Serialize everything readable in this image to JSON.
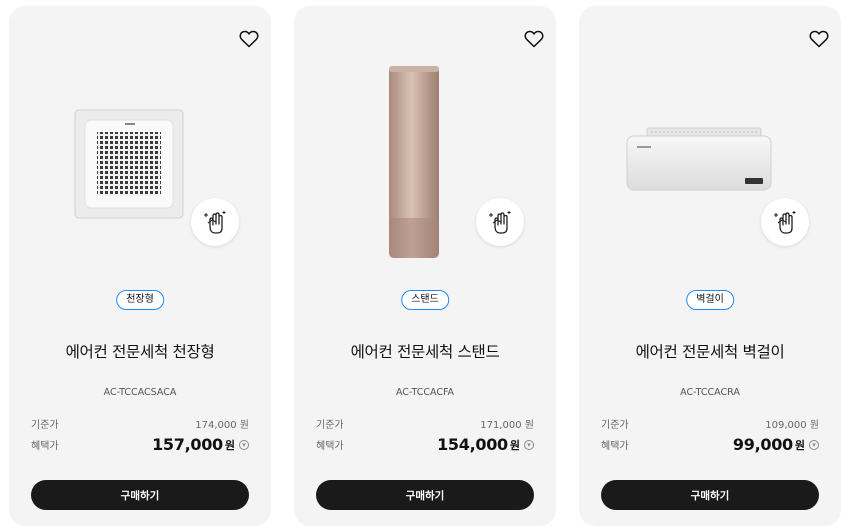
{
  "colors": {
    "accent": "#2189ff",
    "button": "#1a1a1a",
    "card": "#f4f4f4"
  },
  "icons": {
    "wishlist": "heart-outline-icon",
    "clean_service": "hand-wipe-sparkle-icon",
    "info": "info-circle-icon"
  },
  "products": [
    {
      "tag": "천장형",
      "title": "에어컨 전문세척 천장형",
      "model": "AC-TCCACSACA",
      "base_label": "기준가",
      "base_price": "174,000 원",
      "sale_label": "혜택가",
      "sale_price": "157,000",
      "currency": "원",
      "buy_label": "구매하기"
    },
    {
      "tag": "스탠드",
      "title": "에어컨 전문세척 스탠드",
      "model": "AC-TCCACFA",
      "base_label": "기준가",
      "base_price": "171,000 원",
      "sale_label": "혜택가",
      "sale_price": "154,000",
      "currency": "원",
      "buy_label": "구매하기"
    },
    {
      "tag": "벽걸이",
      "title": "에어컨 전문세척 벽걸이",
      "model": "AC-TCCACRA",
      "base_label": "기준가",
      "base_price": "109,000 원",
      "sale_label": "혜택가",
      "sale_price": "99,000",
      "currency": "원",
      "buy_label": "구매하기"
    }
  ]
}
